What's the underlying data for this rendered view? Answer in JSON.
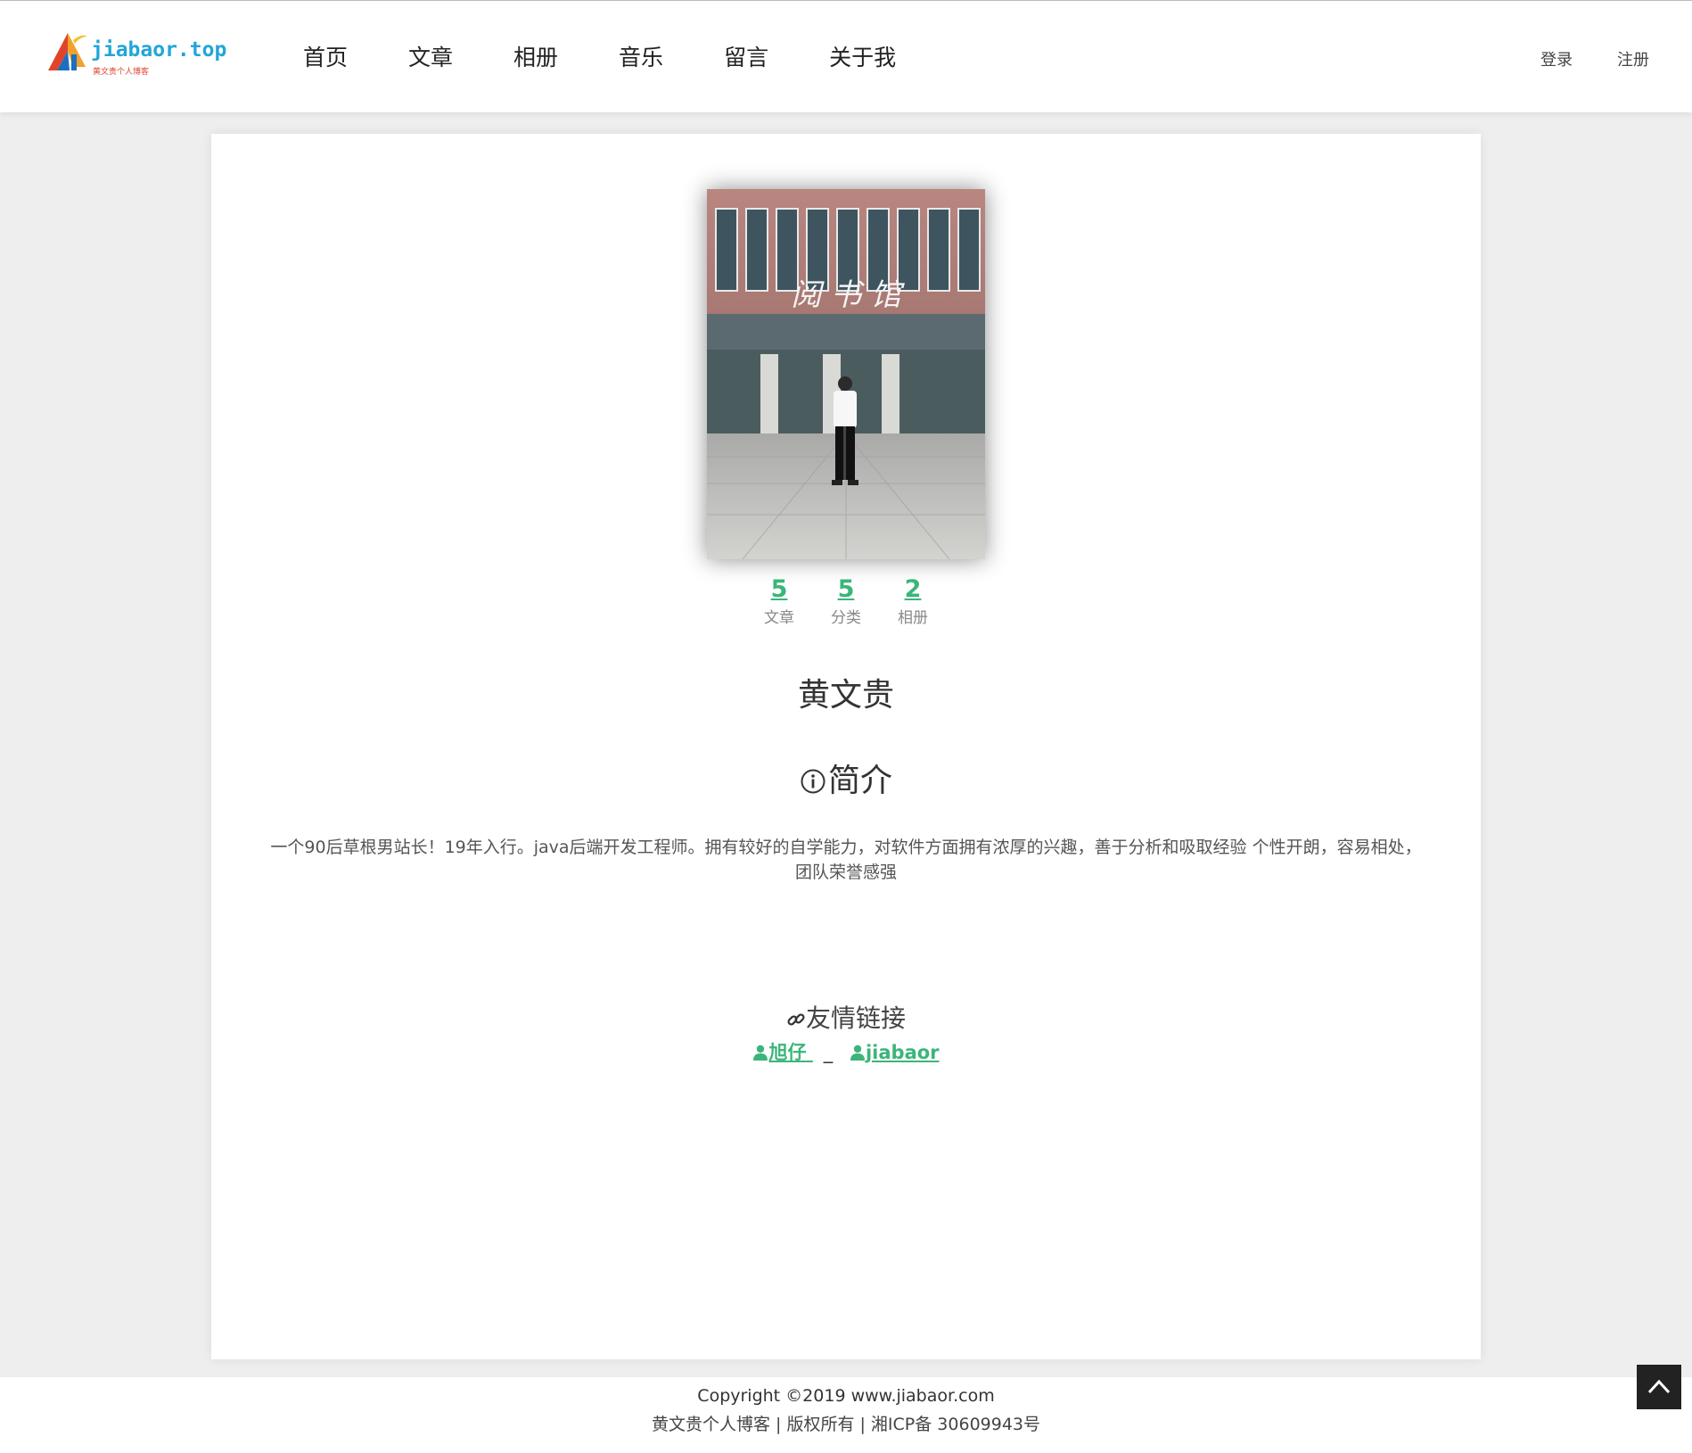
{
  "header": {
    "logo_text": "jiabaor.top",
    "logo_sub": "黄文贵个人博客",
    "nav": [
      {
        "label": "首页"
      },
      {
        "label": "文章"
      },
      {
        "label": "相册"
      },
      {
        "label": "音乐"
      },
      {
        "label": "留言"
      },
      {
        "label": "关于我"
      }
    ],
    "login_label": "登录",
    "register_label": "注册"
  },
  "profile": {
    "photo_sign": "阅 书 馆",
    "stats": [
      {
        "value": "5",
        "label": "文章"
      },
      {
        "value": "5",
        "label": "分类"
      },
      {
        "value": "2",
        "label": "相册"
      }
    ],
    "name": "黄文贵",
    "intro_title": "简介",
    "intro_text": "一个90后草根男站长！19年入行。java后端开发工程师。拥有较好的自学能力，对软件方面拥有浓厚的兴趣，善于分析和吸取经验 个性开朗，容易相处，团队荣誉感强"
  },
  "friends": {
    "title": "友情链接",
    "links": [
      {
        "label": "旭仔"
      },
      {
        "label": "jiabaor"
      }
    ],
    "separator": "_"
  },
  "footer": {
    "copyright": "Copyright ©2019  www.jiabaor.com",
    "rights": "黄文贵个人博客 | 版权所有 | 湘ICP备 30609943号"
  },
  "colors": {
    "accent": "#3bb57a",
    "background": "#eeeeee",
    "logo_blue": "#23a5d8",
    "logo_red": "#e0452a"
  },
  "icons": {
    "info": "info-circle-icon",
    "link": "link-icon",
    "user": "user-icon",
    "back_to_top": "chevron-up-icon"
  }
}
